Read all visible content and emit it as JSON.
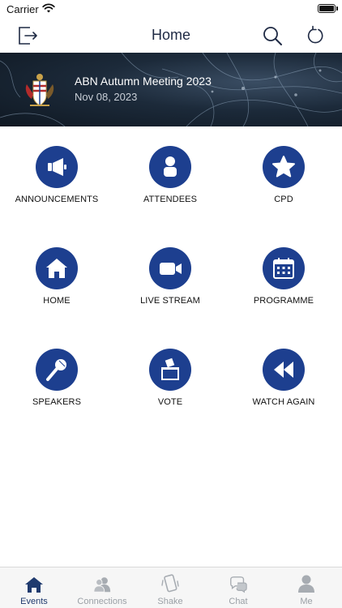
{
  "status_bar": {
    "carrier": "Carrier"
  },
  "nav": {
    "title": "Home",
    "icons": [
      "exit-icon",
      "search-icon",
      "refresh-icon"
    ]
  },
  "event": {
    "title": "ABN Autumn Meeting 2023",
    "date": "Nov 08, 2023"
  },
  "tiles": [
    {
      "label": "ANNOUNCEMENTS",
      "icon": "megaphone-icon"
    },
    {
      "label": "ATTENDEES",
      "icon": "person-icon"
    },
    {
      "label": "CPD",
      "icon": "star-icon"
    },
    {
      "label": "HOME",
      "icon": "house-icon"
    },
    {
      "label": "LIVE STREAM",
      "icon": "video-camera-icon"
    },
    {
      "label": "PROGRAMME",
      "icon": "calendar-icon"
    },
    {
      "label": "SPEAKERS",
      "icon": "microphone-icon"
    },
    {
      "label": "VOTE",
      "icon": "ballot-box-icon"
    },
    {
      "label": "WATCH AGAIN",
      "icon": "rewind-icon"
    }
  ],
  "tabs": [
    {
      "label": "Events",
      "icon": "house-icon",
      "active": true
    },
    {
      "label": "Connections",
      "icon": "people-icon",
      "active": false
    },
    {
      "label": "Shake",
      "icon": "phone-shake-icon",
      "active": false
    },
    {
      "label": "Chat",
      "icon": "chat-bubbles-icon",
      "active": false
    },
    {
      "label": "Me",
      "icon": "person-icon",
      "active": false
    }
  ],
  "colors": {
    "accent": "#1d3f8f",
    "tab_active": "#1f3a6e",
    "tab_inactive": "#9aa0a6"
  }
}
